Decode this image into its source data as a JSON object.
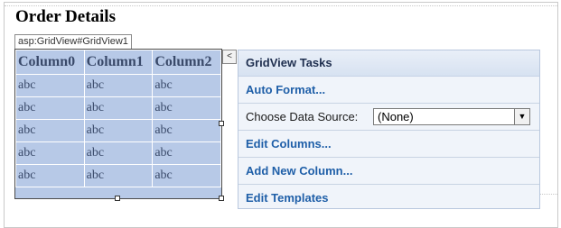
{
  "page": {
    "title": "Order Details"
  },
  "control": {
    "tag": "asp:GridView#GridView1"
  },
  "grid": {
    "columns": [
      "Column0",
      "Column1",
      "Column2"
    ],
    "rows": [
      [
        "abc",
        "abc",
        "abc"
      ],
      [
        "abc",
        "abc",
        "abc"
      ],
      [
        "abc",
        "abc",
        "abc"
      ],
      [
        "abc",
        "abc",
        "abc"
      ],
      [
        "abc",
        "abc",
        "abc"
      ]
    ]
  },
  "smart_tag": {
    "icon": "chevron-left-icon",
    "glyph": "<"
  },
  "tasks": {
    "title": "GridView Tasks",
    "auto_format": "Auto Format...",
    "data_source_label": "Choose Data Source:",
    "data_source_value": "(None)",
    "edit_columns": "Edit Columns...",
    "add_new_column": "Add New Column...",
    "edit_templates": "Edit Templates"
  },
  "colors": {
    "grid_bg": "#b7c9e7",
    "link": "#1f5fa8",
    "panel_bg": "#f0f4fa"
  }
}
